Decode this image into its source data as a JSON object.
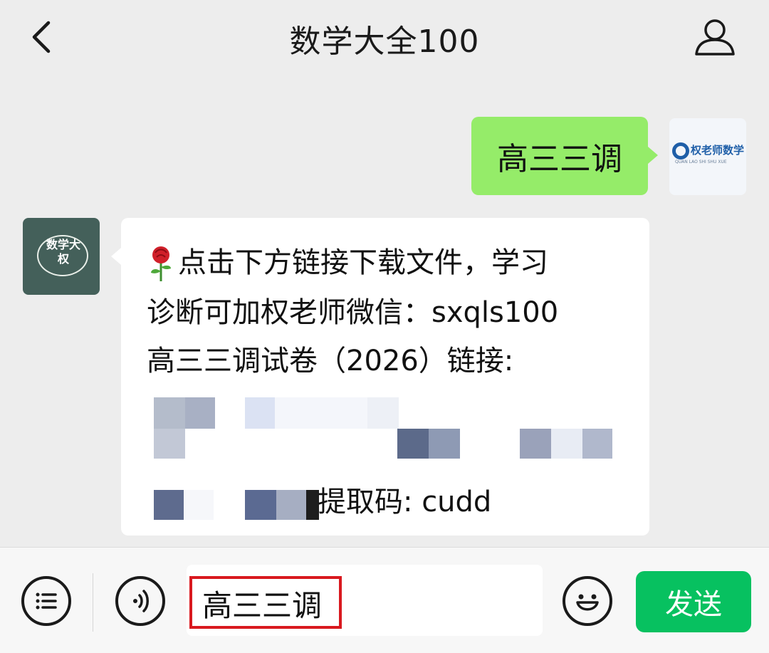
{
  "header": {
    "title": "数学大全100",
    "back_icon": "chevron-left-icon",
    "profile_icon": "person-icon"
  },
  "messages": {
    "sent": {
      "text": "高三三调",
      "bubble_color": "#95ec69"
    },
    "sent_avatar": {
      "brand": "权老师数学",
      "subtitle": "QUAN LAO SHI SHU XUE"
    },
    "received_avatar": {
      "text": "数学大权"
    },
    "received": {
      "line1": "点击下方链接下载文件，学习",
      "line2": "诊断可加权老师微信：sxqls100",
      "line3": "高三三调试卷（2026）链接:",
      "code_text": "提取码: cudd",
      "icon": "rose-icon"
    }
  },
  "input_bar": {
    "menu_icon": "list-icon",
    "voice_icon": "voice-icon",
    "input_value": "高三三调",
    "emoji_icon": "emoji-icon",
    "send_label": "发送",
    "send_color": "#07c160",
    "highlight_color": "#d9191f"
  }
}
